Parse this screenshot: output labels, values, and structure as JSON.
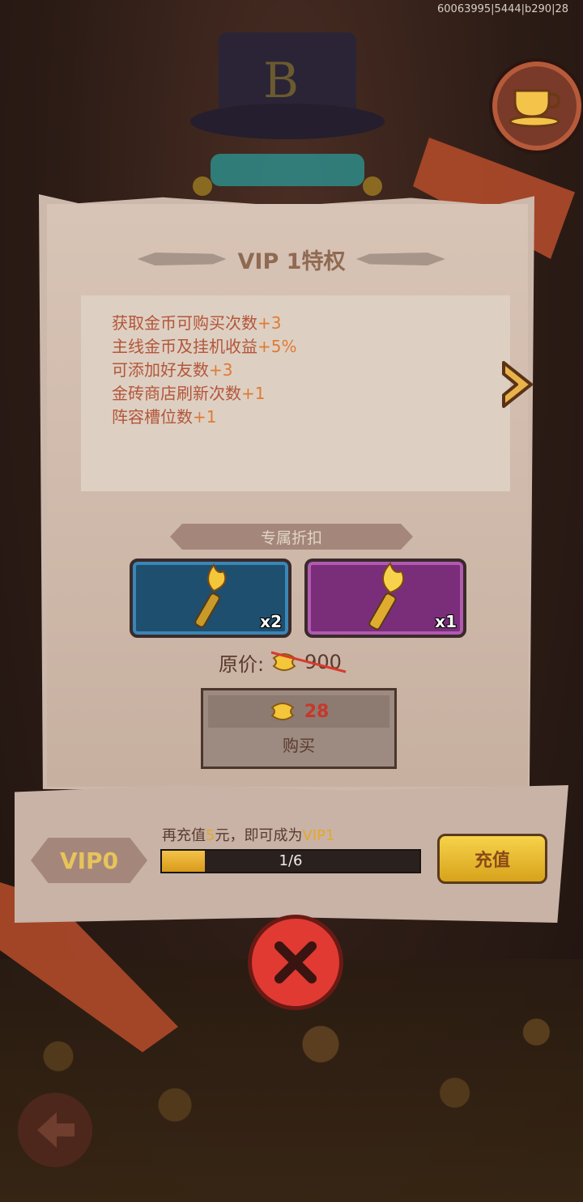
{
  "debug": {
    "text": "60063995|5444|b290|28"
  },
  "panel": {
    "title": "VIP 1特权",
    "perks": [
      {
        "text": "获取金币可购买次数",
        "bonus": "+3"
      },
      {
        "text": "主线金币及挂机收益",
        "bonus": "+5%"
      },
      {
        "text": "可添加好友数",
        "bonus": "+3"
      },
      {
        "text": "金砖商店刷新次数",
        "bonus": "+1"
      },
      {
        "text": "阵容槽位数",
        "bonus": "+1"
      }
    ],
    "discount_label": "专属折扣",
    "items": [
      {
        "icon": "torch-blue-icon",
        "qty": "x2",
        "color": "#1f4f6e"
      },
      {
        "icon": "torch-purple-icon",
        "qty": "x1",
        "color": "#7a2e7a"
      }
    ],
    "original_price_label": "原价:",
    "original_price": "900",
    "buy_price": "28",
    "buy_label": "购买"
  },
  "vip": {
    "current_level": "VIP0",
    "hint_prefix": "再充值",
    "hint_amount": "5",
    "hint_middle": "元，即可成为",
    "hint_target": "VIP1",
    "progress_text": "1/6",
    "progress_fraction": 0.1667,
    "recharge_label": "充值"
  },
  "colors": {
    "accent_gold": "#e7c35c",
    "price_red": "#c8372a",
    "bonus_orange": "#e07a36"
  }
}
